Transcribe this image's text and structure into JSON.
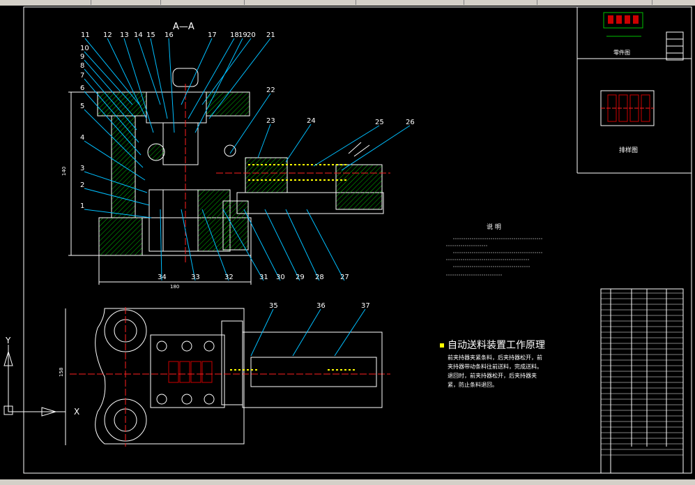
{
  "section_label": "A—A",
  "callouts_top": [
    "11",
    "12",
    "13",
    "14",
    "15",
    "16",
    "17",
    "18",
    "19",
    "20",
    "21"
  ],
  "callouts_left": [
    "10",
    "9",
    "8",
    "7",
    "6",
    "5",
    "4",
    "3",
    "2",
    "1"
  ],
  "callouts_right": [
    "22",
    "23",
    "24",
    "25",
    "26"
  ],
  "callouts_bottom": [
    "34",
    "33",
    "32",
    "31",
    "30",
    "29",
    "28",
    "27"
  ],
  "callouts_plan": [
    "35",
    "36",
    "37"
  ],
  "dim_height": "140",
  "dim_width": "180",
  "dim_plan": "158",
  "part_drawing_label": "零件图",
  "layout_drawing_label": "排样图",
  "notes_title": "说  明",
  "principle_title": "自动送料装置工作原理",
  "principle_body": "前夹持器夹紧条料，后夹持器松开，前夹持器带动条料往前送料，完成送料。退回时，前夹持器松开，后夹持器夹紧，防止条料退回。",
  "ucs_x": "X",
  "ucs_y": "Y",
  "colors": {
    "outline": "#ffffff",
    "hatch": "#00c000",
    "leader": "#00bfff",
    "center": "#ff2020",
    "spring": "#ffff00",
    "title_block": "#ffffff"
  }
}
